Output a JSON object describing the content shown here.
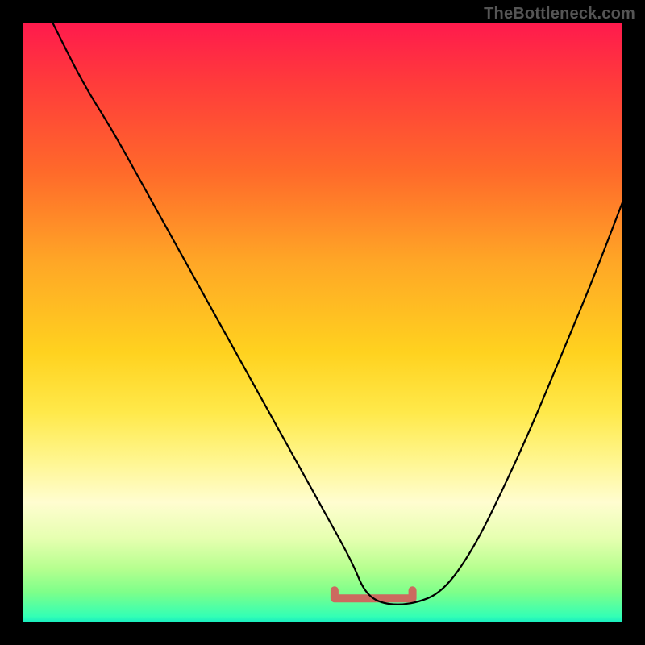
{
  "watermark": "TheBottleneck.com",
  "chart_data": {
    "type": "line",
    "title": "",
    "xlabel": "",
    "ylabel": "",
    "xlim": [
      0,
      100
    ],
    "ylim": [
      0,
      100
    ],
    "grid": false,
    "series": [
      {
        "name": "bottleneck-curve",
        "color": "#000000",
        "x": [
          5,
          10,
          15,
          20,
          25,
          30,
          35,
          40,
          45,
          50,
          55,
          57,
          60,
          65,
          70,
          75,
          80,
          85,
          90,
          95,
          100
        ],
        "values": [
          100,
          90,
          82,
          73,
          64,
          55,
          46,
          37,
          28,
          19,
          10,
          5,
          3,
          3,
          5,
          12,
          22,
          33,
          45,
          57,
          70
        ]
      }
    ],
    "annotations": [
      {
        "name": "optimal-region",
        "x_range": [
          52,
          65
        ],
        "value": 4,
        "color": "#cc6a5f"
      }
    ]
  }
}
